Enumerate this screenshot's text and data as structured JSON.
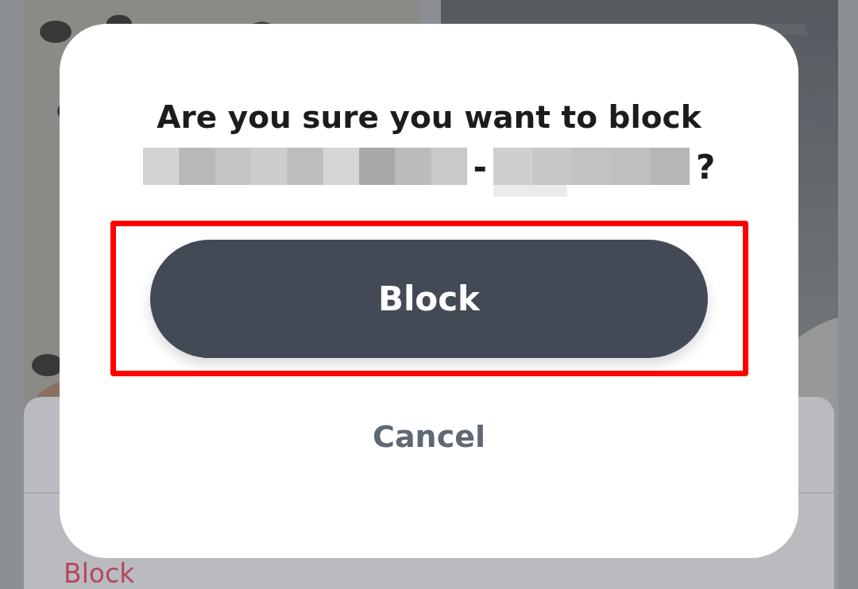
{
  "background": {
    "sheet": {
      "action": "Block"
    }
  },
  "dialog": {
    "title": "Are you sure you want to block",
    "name_separator": "-",
    "question_mark": "?",
    "confirm": {
      "label": "Block",
      "highlighted": true
    },
    "cancel": {
      "label": "Cancel"
    }
  }
}
